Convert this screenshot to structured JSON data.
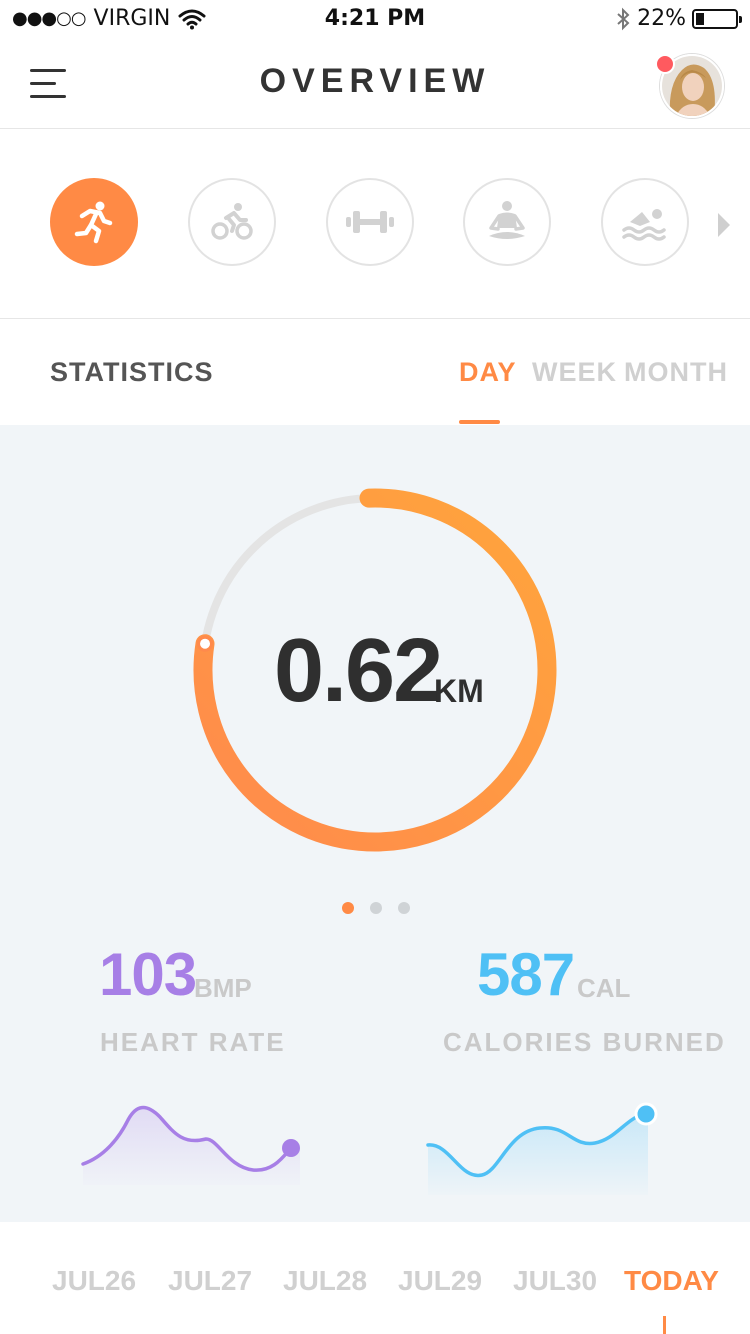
{
  "status_bar": {
    "signal_dots": "●●●○○",
    "carrier": "VIRGIN",
    "time": "4:21 PM",
    "battery_percent": "22%",
    "battery_level": 0.22
  },
  "header": {
    "title": "OVERVIEW"
  },
  "activities": [
    {
      "icon": "running-icon",
      "active": true
    },
    {
      "icon": "cycling-icon",
      "active": false
    },
    {
      "icon": "dumbbell-icon",
      "active": false
    },
    {
      "icon": "yoga-icon",
      "active": false
    },
    {
      "icon": "swimming-icon",
      "active": false
    }
  ],
  "statistics": {
    "label": "STATISTICS",
    "tabs": [
      "DAY",
      "WEEK",
      "MONTH"
    ],
    "active_tab": "DAY"
  },
  "distance": {
    "value": "0.62",
    "unit": "KM",
    "progress": 0.78
  },
  "pager": {
    "count": 3,
    "active": 0
  },
  "metrics": {
    "heart_rate": {
      "value": "103",
      "unit": "BMP",
      "label": "HEART RATE",
      "color": "#a77fe6"
    },
    "calories": {
      "value": "587",
      "unit": "CAL",
      "label": "CALORIES BURNED",
      "color": "#4fc0f5"
    }
  },
  "colors": {
    "accent": "#ff8a45",
    "accent_light": "#ffa53f",
    "panel_bg": "#f1f5f8"
  },
  "dates": [
    "JUL26",
    "JUL27",
    "JUL28",
    "JUL29",
    "JUL30",
    "TODAY"
  ],
  "active_date": "TODAY"
}
